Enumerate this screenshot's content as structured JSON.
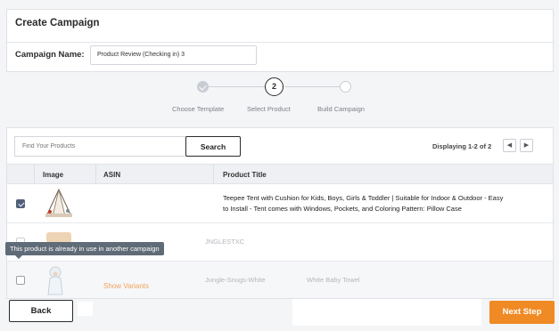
{
  "header": {
    "title": "Create Campaign",
    "campaign_name_label": "Campaign Name:",
    "campaign_name_value": "Product Review (Checking in) 3"
  },
  "stepper": {
    "current_step_number": "2",
    "steps": [
      {
        "label": "Choose Template",
        "state": "done"
      },
      {
        "label": "Select Product",
        "state": "active"
      },
      {
        "label": "Build Campaign",
        "state": "pending"
      }
    ]
  },
  "products": {
    "search_placeholder": "Find Your Products",
    "search_button": "Search",
    "displaying": "Displaying  1-2  of 2",
    "pager": {
      "prev_icon": "chevron-left-icon",
      "next_icon": "chevron-right-icon"
    },
    "columns": [
      "Image",
      "ASIN",
      "Product Title"
    ],
    "rows": [
      {
        "checked": true,
        "image": "tent-product-image",
        "asin": "",
        "title_line1": "Teepee Tent with Cushion for Kids, Boys, Girls & Toddler | Suitable for Indoor & Outdoor - Easy",
        "title_line2": "to Install - Tent comes with Windows, Pockets, and Coloring Pattern: Pillow Case"
      },
      {
        "checked": false,
        "image": "brush-product-image",
        "asin": "JNGLESTXC",
        "title": ""
      },
      {
        "checked": false,
        "image": "towel-product-image",
        "show_variants": "Show Variants",
        "asin": "Jungle-Snugs-White",
        "title": "White Baby Towel"
      }
    ],
    "tooltip": "This product is already in use in another campaign"
  },
  "footer": {
    "back_label": "Back",
    "next_label": "Next Step",
    "accent_color": "#f08a24"
  }
}
